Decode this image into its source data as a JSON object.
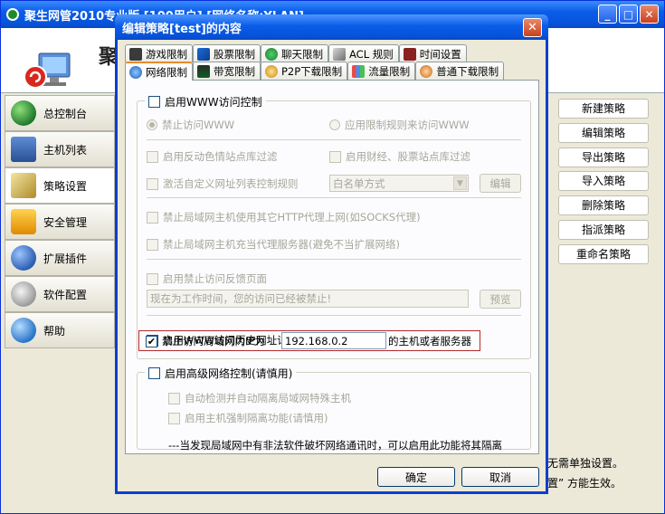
{
  "main_window": {
    "title": "聚生网管2010专业版 [100用户] [网络名称:YLAN]",
    "banner_text": "聚"
  },
  "sidebar": {
    "items": [
      {
        "label": "总控制台",
        "icon": "globe-icon"
      },
      {
        "label": "主机列表",
        "icon": "star-monitor-icon"
      },
      {
        "label": "策略设置",
        "icon": "tools-icon"
      },
      {
        "label": "安全管理",
        "icon": "lock-icon"
      },
      {
        "label": "扩展插件",
        "icon": "plugin-icon"
      },
      {
        "label": "软件配置",
        "icon": "wrench-icon"
      },
      {
        "label": "帮助",
        "icon": "help-icon"
      }
    ],
    "active_index": 2
  },
  "right_buttons": [
    "新建策略",
    "编辑策略",
    "导出策略",
    "导入策略",
    "删除策略",
    "指派策略",
    "重命名策略"
  ],
  "background_text": {
    "line1": "无需单独设置。",
    "line2": "置” 方能生效。"
  },
  "dialog": {
    "title": "编辑策略[test]的内容",
    "tabs_row1": [
      {
        "label": "游戏限制",
        "icon": "game-icon"
      },
      {
        "label": "股票限制",
        "icon": "stock-icon"
      },
      {
        "label": "聊天限制",
        "icon": "chat-icon"
      },
      {
        "label": "ACL 规则",
        "icon": "acl-icon"
      },
      {
        "label": "时间设置",
        "icon": "clock-icon"
      }
    ],
    "tabs_row2": [
      {
        "label": "网络限制",
        "icon": "network-icon",
        "active": true
      },
      {
        "label": "带宽限制",
        "icon": "bandwidth-icon"
      },
      {
        "label": "P2P下载限制",
        "icon": "p2p-icon"
      },
      {
        "label": "流量限制",
        "icon": "traffic-icon"
      },
      {
        "label": "普通下载限制",
        "icon": "download-icon"
      }
    ],
    "www_group": {
      "enable_label": "启用WWW访问控制",
      "radio_deny": "禁止访问WWW",
      "radio_rule": "应用限制规则来访问WWW",
      "filter_porn": "启用反动色情站点库过滤",
      "filter_finance": "启用财经、股票站点库过滤",
      "custom_rule": "激活自定义网址列表控制规则",
      "whitelist_mode": "白名单方式",
      "edit_button": "编辑",
      "block_proxy_use": "禁止局域网主机使用其它HTTP代理上网(如SOCKS代理)",
      "block_proxy_server": "禁止局域网主机充当代理服务器(避免不当扩展网络)",
      "feedback_page": "启用禁止访问反馈页面",
      "feedback_text": "现在为工作时间，您的访问已经被禁止!",
      "preview_button": "预览",
      "history_label": "启用WWW访问历史网址记录",
      "block_ip_label": "禁止访问局域网内IP为",
      "block_ip_value": "192.168.0.2",
      "block_ip_suffix": "的主机或者服务器"
    },
    "advanced_group": {
      "enable_label": "启用高级网络控制(请慎用)",
      "auto_detect": "自动检测并自动隔离局域网特殊主机",
      "force_isolate": "启用主机强制隔离功能(请慎用)"
    },
    "note": "---当发现局域网中有非法软件破坏网络通讯时，可以启用此功能将其隔离",
    "ok_button": "确定",
    "cancel_button": "取消"
  }
}
